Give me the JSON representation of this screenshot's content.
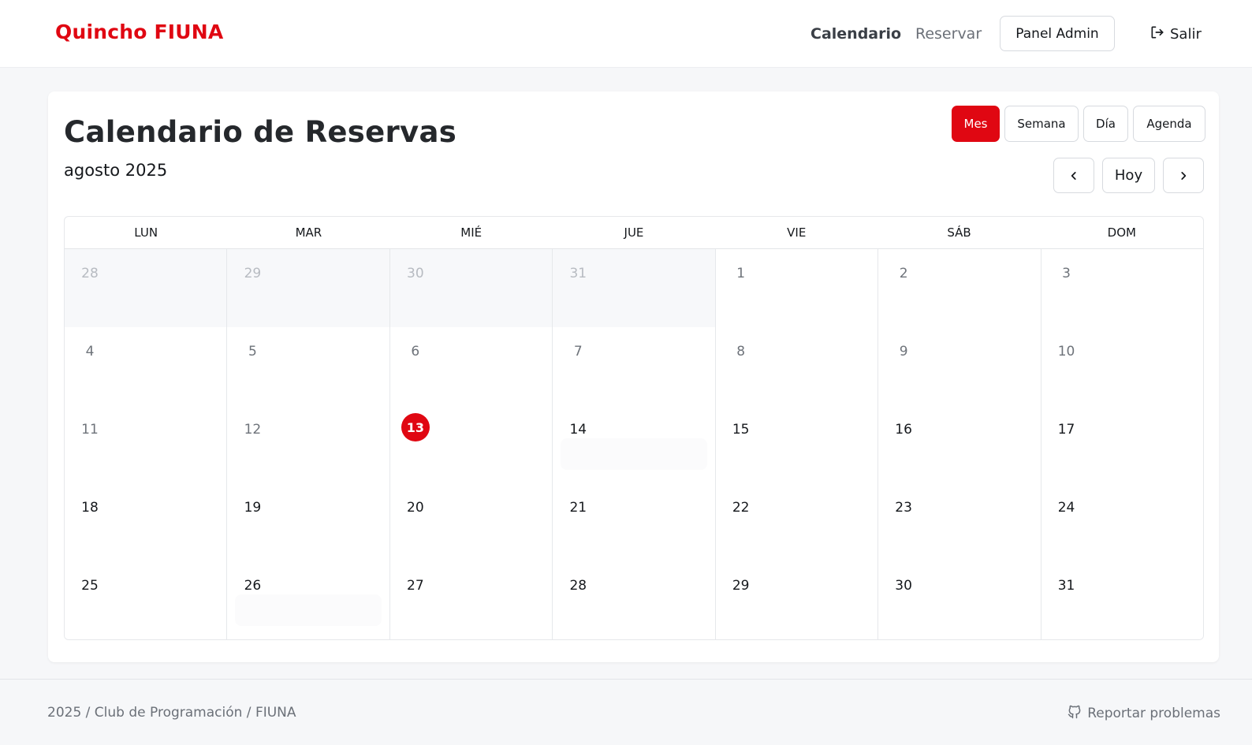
{
  "header": {
    "brand": "Quincho FIUNA",
    "nav": {
      "calendar": "Calendario",
      "reserve": "Reservar"
    },
    "admin_button": "Panel Admin",
    "logout": {
      "label": "Salir",
      "icon": "logout-icon"
    }
  },
  "calendar": {
    "title": "Calendario de Reservas",
    "period": "agosto 2025",
    "views": [
      {
        "label": "Mes",
        "active": true
      },
      {
        "label": "Semana",
        "active": false
      },
      {
        "label": "Día",
        "active": false
      },
      {
        "label": "Agenda",
        "active": false
      }
    ],
    "nav": {
      "prev_icon": "chevron-left-icon",
      "today": "Hoy",
      "next_icon": "chevron-right-icon"
    },
    "weekdays": [
      "LUN",
      "MAR",
      "MIÉ",
      "JUE",
      "VIE",
      "SÁB",
      "DOM"
    ],
    "weeks": [
      [
        {
          "day": "28",
          "state": "off"
        },
        {
          "day": "29",
          "state": "off"
        },
        {
          "day": "30",
          "state": "off"
        },
        {
          "day": "31",
          "state": "off"
        },
        {
          "day": "1",
          "state": "past"
        },
        {
          "day": "2",
          "state": "past"
        },
        {
          "day": "3",
          "state": "past"
        }
      ],
      [
        {
          "day": "4",
          "state": "past"
        },
        {
          "day": "5",
          "state": "past"
        },
        {
          "day": "6",
          "state": "past"
        },
        {
          "day": "7",
          "state": "past"
        },
        {
          "day": "8",
          "state": "past"
        },
        {
          "day": "9",
          "state": "past"
        },
        {
          "day": "10",
          "state": "past"
        }
      ],
      [
        {
          "day": "11",
          "state": "past"
        },
        {
          "day": "12",
          "state": "past"
        },
        {
          "day": "13",
          "state": "today"
        },
        {
          "day": "14",
          "state": "future",
          "ghost": true
        },
        {
          "day": "15",
          "state": "future"
        },
        {
          "day": "16",
          "state": "future"
        },
        {
          "day": "17",
          "state": "future"
        }
      ],
      [
        {
          "day": "18",
          "state": "future"
        },
        {
          "day": "19",
          "state": "future"
        },
        {
          "day": "20",
          "state": "future"
        },
        {
          "day": "21",
          "state": "future"
        },
        {
          "day": "22",
          "state": "future"
        },
        {
          "day": "23",
          "state": "future"
        },
        {
          "day": "24",
          "state": "future"
        }
      ],
      [
        {
          "day": "25",
          "state": "future"
        },
        {
          "day": "26",
          "state": "future",
          "ghost": true
        },
        {
          "day": "27",
          "state": "future"
        },
        {
          "day": "28",
          "state": "future"
        },
        {
          "day": "29",
          "state": "future"
        },
        {
          "day": "30",
          "state": "future"
        },
        {
          "day": "31",
          "state": "future"
        }
      ]
    ]
  },
  "footer": {
    "credit": "2025 / Club de Programación / FIUNA",
    "report": {
      "label": "Reportar problemas",
      "icon": "github-icon"
    }
  },
  "colors": {
    "accent": "#e00712",
    "muted_text": "#6b7078",
    "off_day_bg": "#f7f8fa"
  }
}
